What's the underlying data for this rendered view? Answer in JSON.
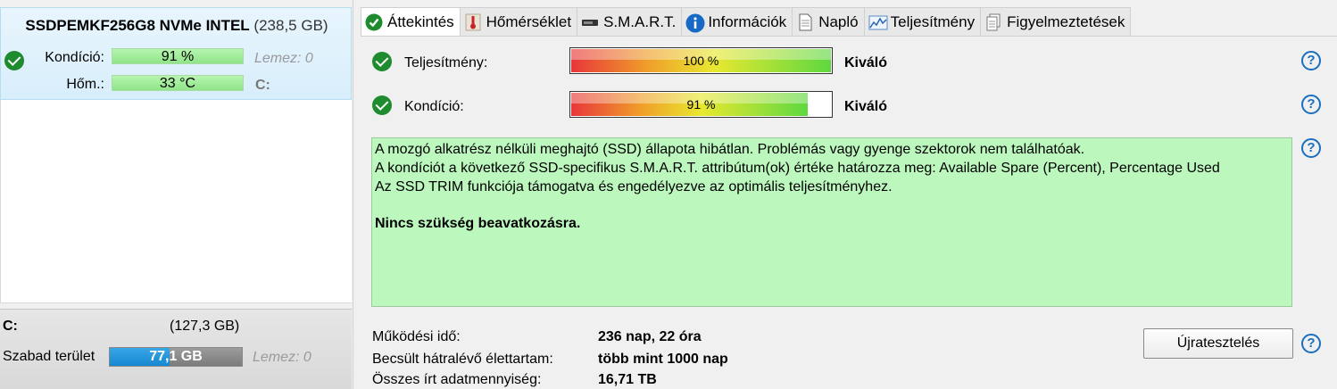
{
  "disk": {
    "model": "SSDPEMKF256G8 NVMe INTEL",
    "size": "(238,5 GB)",
    "health_label": "Kondíció:",
    "health_value": "91 %",
    "health_side": "Lemez: 0",
    "temp_label": "Hőm.:",
    "temp_value": "33 °C",
    "temp_side": "C:"
  },
  "volume": {
    "name": "C:",
    "size": "(127,3 GB)",
    "free_label": "Szabad terület",
    "free_value": "77,1 GB",
    "free_fraction": 0.45,
    "disk_ref": "Lemez: 0"
  },
  "tabs": [
    {
      "label": "Áttekintés",
      "icon": "check-icon",
      "active": true
    },
    {
      "label": "Hőmérséklet",
      "icon": "thermometer-icon",
      "active": false
    },
    {
      "label": "S.M.A.R.T.",
      "icon": "drive-icon",
      "active": false
    },
    {
      "label": "Információk",
      "icon": "info-icon",
      "active": false
    },
    {
      "label": "Napló",
      "icon": "document-icon",
      "active": false
    },
    {
      "label": "Teljesítmény",
      "icon": "chart-icon",
      "active": false
    },
    {
      "label": "Figyelmeztetések",
      "icon": "pages-icon",
      "active": false
    }
  ],
  "performance": {
    "label": "Teljesítmény:",
    "value": "100 %",
    "fraction": 1.0,
    "verdict": "Kiváló"
  },
  "health": {
    "label": "Kondíció:",
    "value": "91 %",
    "fraction": 0.91,
    "verdict": "Kiváló"
  },
  "info_lines": [
    "A mozgó alkatrész nélküli meghajtó (SSD) állapota hibátlan. Problémás vagy gyenge szektorok nem találhatóak.",
    "A kondíciót a következő SSD-specifikus S.M.A.R.T. attribútum(ok) értéke határozza meg:  Available Spare (Percent), Percentage Used",
    "Az SSD TRIM funkciója támogatva és engedélyezve az optimális teljesítményhez."
  ],
  "info_conclusion": "Nincs szükség beavatkozásra.",
  "stats": {
    "uptime_label": "Működési idő:",
    "uptime_value": "236 nap, 22 óra",
    "lifetime_label": "Becsült hátralévő élettartam:",
    "lifetime_value": "több mint 1000 nap",
    "written_label": "Összes írt adatmennyiség:",
    "written_value": "16,71 TB"
  },
  "retest_label": "Újratesztelés",
  "help_glyph": "?",
  "colors": {
    "ok_green": "#1f8b2f",
    "info_bg": "#bcf7be",
    "accent_blue": "#1a6fc0",
    "free_bar": "#1688d2"
  }
}
